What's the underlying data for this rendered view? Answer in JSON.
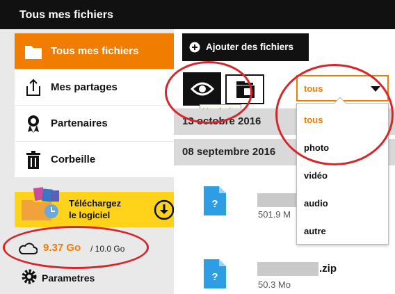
{
  "title": "Tous mes fichiers",
  "sidebar": {
    "items": [
      {
        "label": "Tous mes fichiers",
        "icon": "folder-icon",
        "active": true
      },
      {
        "label": "Mes partages",
        "icon": "share-icon"
      },
      {
        "label": "Partenaires",
        "icon": "award-icon"
      },
      {
        "label": "Corbeille",
        "icon": "trash-icon"
      }
    ],
    "download": {
      "line1": "Téléchargez",
      "line2": "le logiciel"
    },
    "storage": {
      "used": "9.37 Go",
      "total": "/ 10.0 Go"
    },
    "settings": "Parametres"
  },
  "toolbar": {
    "add_label": "Ajouter des fichiers",
    "tooltip": "Vue à plat"
  },
  "filter": {
    "selected": "tous",
    "options": [
      "tous",
      "photo",
      "vidéo",
      "audio",
      "autre"
    ]
  },
  "groups": [
    {
      "date": "13 octobre 2016"
    },
    {
      "date": "08 septembre 2016"
    }
  ],
  "files": [
    {
      "ext": "",
      "size": "501.9 M"
    },
    {
      "ext": ".zip",
      "size": "50.3 Mo"
    }
  ],
  "colors": {
    "accent": "#f07c00",
    "highlight": "#ffd31a",
    "annotation": "#d6262b"
  }
}
